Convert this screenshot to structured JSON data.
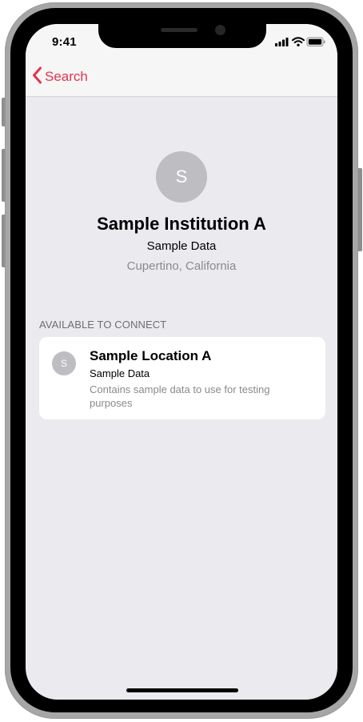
{
  "status_bar": {
    "time": "9:41",
    "icons": [
      "signal-icon",
      "wifi-icon",
      "battery-icon"
    ]
  },
  "nav": {
    "back_label": "Search",
    "back_icon": "chevron-left-icon"
  },
  "institution": {
    "avatar_letter": "S",
    "name": "Sample Institution A",
    "source": "Sample Data",
    "location": "Cupertino, California"
  },
  "section": {
    "header": "AVAILABLE TO CONNECT"
  },
  "locations": [
    {
      "avatar_letter": "S",
      "name": "Sample Location A",
      "source": "Sample Data",
      "description": "Contains sample data to use for testing purposes"
    }
  ],
  "colors": {
    "accent": "#e5334b",
    "background": "#ebeaef",
    "avatar": "#bebdc2",
    "secondary_text": "#8a8a8e"
  }
}
